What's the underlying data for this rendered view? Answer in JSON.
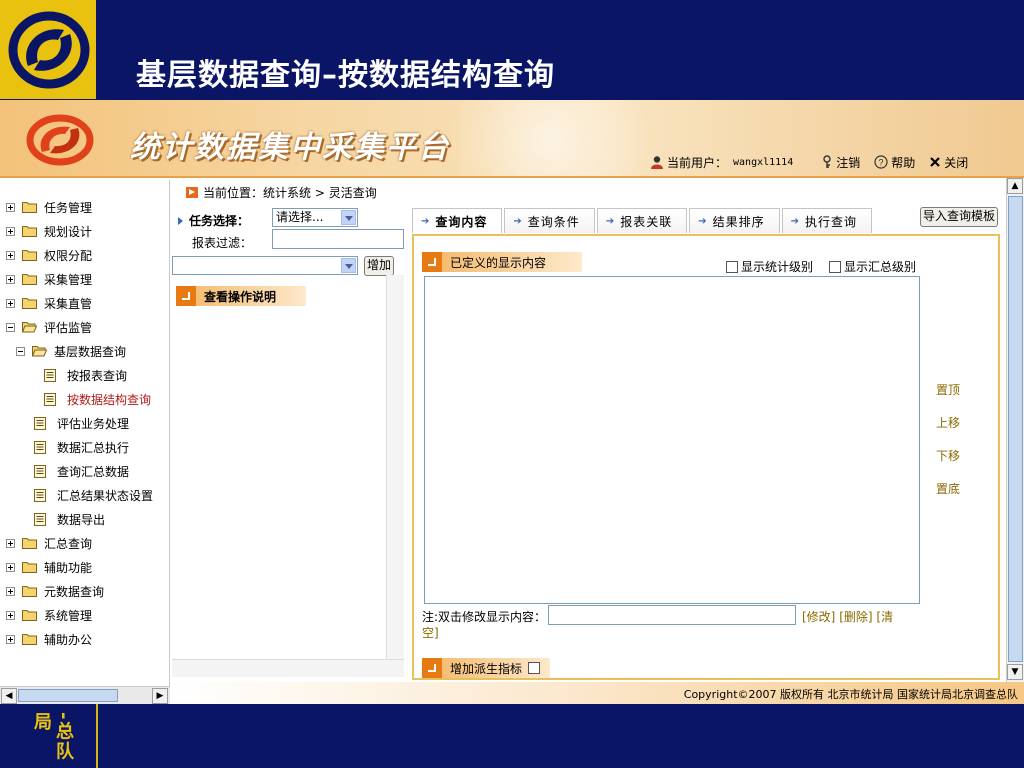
{
  "slide": {
    "title": "基层数据查询–按数据结构查询",
    "bottom_text": "-总队局"
  },
  "app": {
    "title": "统计数据集中采集平台",
    "current_user_label": "当前用户：",
    "current_user": "wangxl1114",
    "logout": "注销",
    "help": "帮助",
    "close": "关闭"
  },
  "nav": {
    "items": [
      {
        "label": "任务管理",
        "level": 0,
        "type": "folder",
        "expanded": false
      },
      {
        "label": "规划设计",
        "level": 0,
        "type": "folder",
        "expanded": false
      },
      {
        "label": "权限分配",
        "level": 0,
        "type": "folder",
        "expanded": false
      },
      {
        "label": "采集管理",
        "level": 0,
        "type": "folder",
        "expanded": false
      },
      {
        "label": "采集直管",
        "level": 0,
        "type": "folder",
        "expanded": false
      },
      {
        "label": "评估监管",
        "level": 0,
        "type": "folder",
        "expanded": true
      },
      {
        "label": "基层数据查询",
        "level": 1,
        "type": "folder",
        "expanded": true
      },
      {
        "label": "按报表查询",
        "level": 2,
        "type": "doc"
      },
      {
        "label": "按数据结构查询",
        "level": 2,
        "type": "doc",
        "active": true
      },
      {
        "label": "评估业务处理",
        "level": 1,
        "type": "doc"
      },
      {
        "label": "数据汇总执行",
        "level": 1,
        "type": "doc"
      },
      {
        "label": "查询汇总数据",
        "level": 1,
        "type": "doc"
      },
      {
        "label": "汇总结果状态设置",
        "level": 1,
        "type": "doc"
      },
      {
        "label": "数据导出",
        "level": 1,
        "type": "doc"
      },
      {
        "label": "汇总查询",
        "level": 0,
        "type": "folder",
        "expanded": false
      },
      {
        "label": "辅助功能",
        "level": 0,
        "type": "folder",
        "expanded": false
      },
      {
        "label": "元数据查询",
        "level": 0,
        "type": "folder",
        "expanded": false
      },
      {
        "label": "系统管理",
        "level": 0,
        "type": "folder",
        "expanded": false
      },
      {
        "label": "辅助办公",
        "level": 0,
        "type": "folder",
        "expanded": false
      }
    ]
  },
  "breadcrumb": {
    "label": "当前位置：",
    "path": "统计系统 > 灵活查询"
  },
  "task": {
    "label": "任务选择：",
    "select_value": "请选择...",
    "filter_label": "报表过滤：",
    "filter_value": "",
    "second_select_value": "",
    "add_button": "增加",
    "instructions": "查看操作说明"
  },
  "tabs": [
    {
      "label": "查询内容",
      "active": true
    },
    {
      "label": "查询条件",
      "active": false
    },
    {
      "label": "报表关联",
      "active": false
    },
    {
      "label": "结果排序",
      "active": false
    },
    {
      "label": "执行查询",
      "active": false
    }
  ],
  "import_button": "导入查询模板",
  "content": {
    "defined_label": "已定义的显示内容",
    "show_stat_level": "显示统计级别",
    "show_summary_level": "显示汇总级别",
    "show_stat_level_checked": false,
    "show_summary_level_checked": false,
    "side_actions": [
      "置顶",
      "上移",
      "下移",
      "置底"
    ],
    "note_label": "注:双击修改显示内容：",
    "note_value": "",
    "modify": "[修改]",
    "delete": "[删除]",
    "clear_a": "[清",
    "clear_b": "空]",
    "derive_label": "增加派生指标",
    "derive_checked": false
  },
  "footer": {
    "copyright": "Copyright©2007 版权所有 北京市统计局 国家统计局北京调查总队"
  },
  "colors": {
    "slide_bg": "#0b1565",
    "slide_accent": "#e8c20f",
    "active_nav": "#b11a1a",
    "link": "#8b6a00",
    "tag_orange": "#e77a12"
  }
}
